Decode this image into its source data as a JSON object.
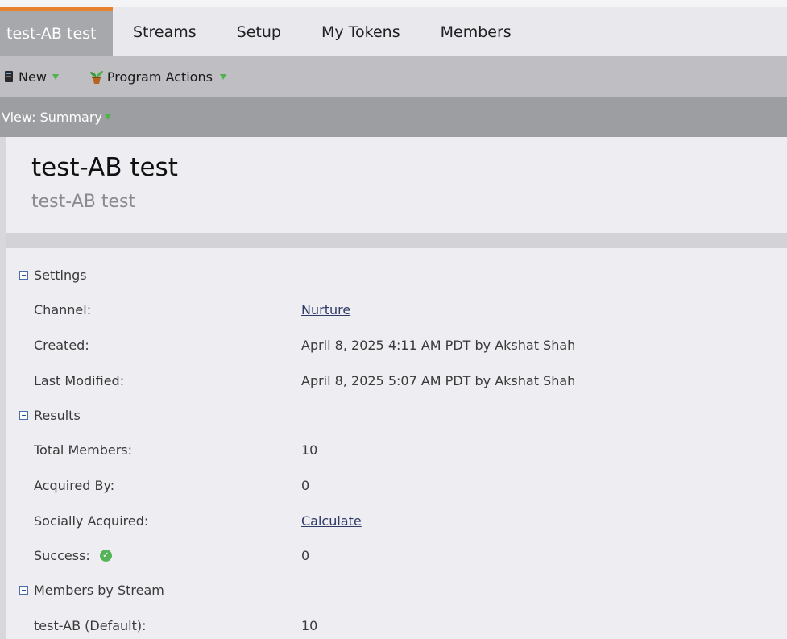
{
  "tabs": [
    {
      "label": "test-AB test",
      "active": true
    },
    {
      "label": "Streams"
    },
    {
      "label": "Setup"
    },
    {
      "label": "My Tokens"
    },
    {
      "label": "Members"
    }
  ],
  "toolbar": {
    "new_label": "New",
    "program_actions_label": "Program Actions"
  },
  "viewbar": {
    "view_label": "View: Summary"
  },
  "header": {
    "title": "test-AB test",
    "subtitle": "test-AB test"
  },
  "settings": {
    "heading": "Settings",
    "channel_label": "Channel:",
    "channel_value": "Nurture",
    "created_label": "Created:",
    "created_value": "April 8, 2025 4:11 AM PDT by Akshat Shah",
    "modified_label": "Last Modified:",
    "modified_value": "April 8, 2025 5:07 AM PDT by Akshat Shah"
  },
  "results": {
    "heading": "Results",
    "total_label": "Total Members:",
    "total_value": "10",
    "acquired_label": "Acquired By:",
    "acquired_value": "0",
    "social_label": "Socially Acquired:",
    "social_value": "Calculate",
    "success_label": "Success:",
    "success_value": "0"
  },
  "streams": {
    "heading": "Members by Stream",
    "row_label": "test-AB (Default):",
    "row_value": "10"
  },
  "colors": {
    "accent": "#e8812d",
    "link": "#2f3b66",
    "success": "#57b357"
  }
}
